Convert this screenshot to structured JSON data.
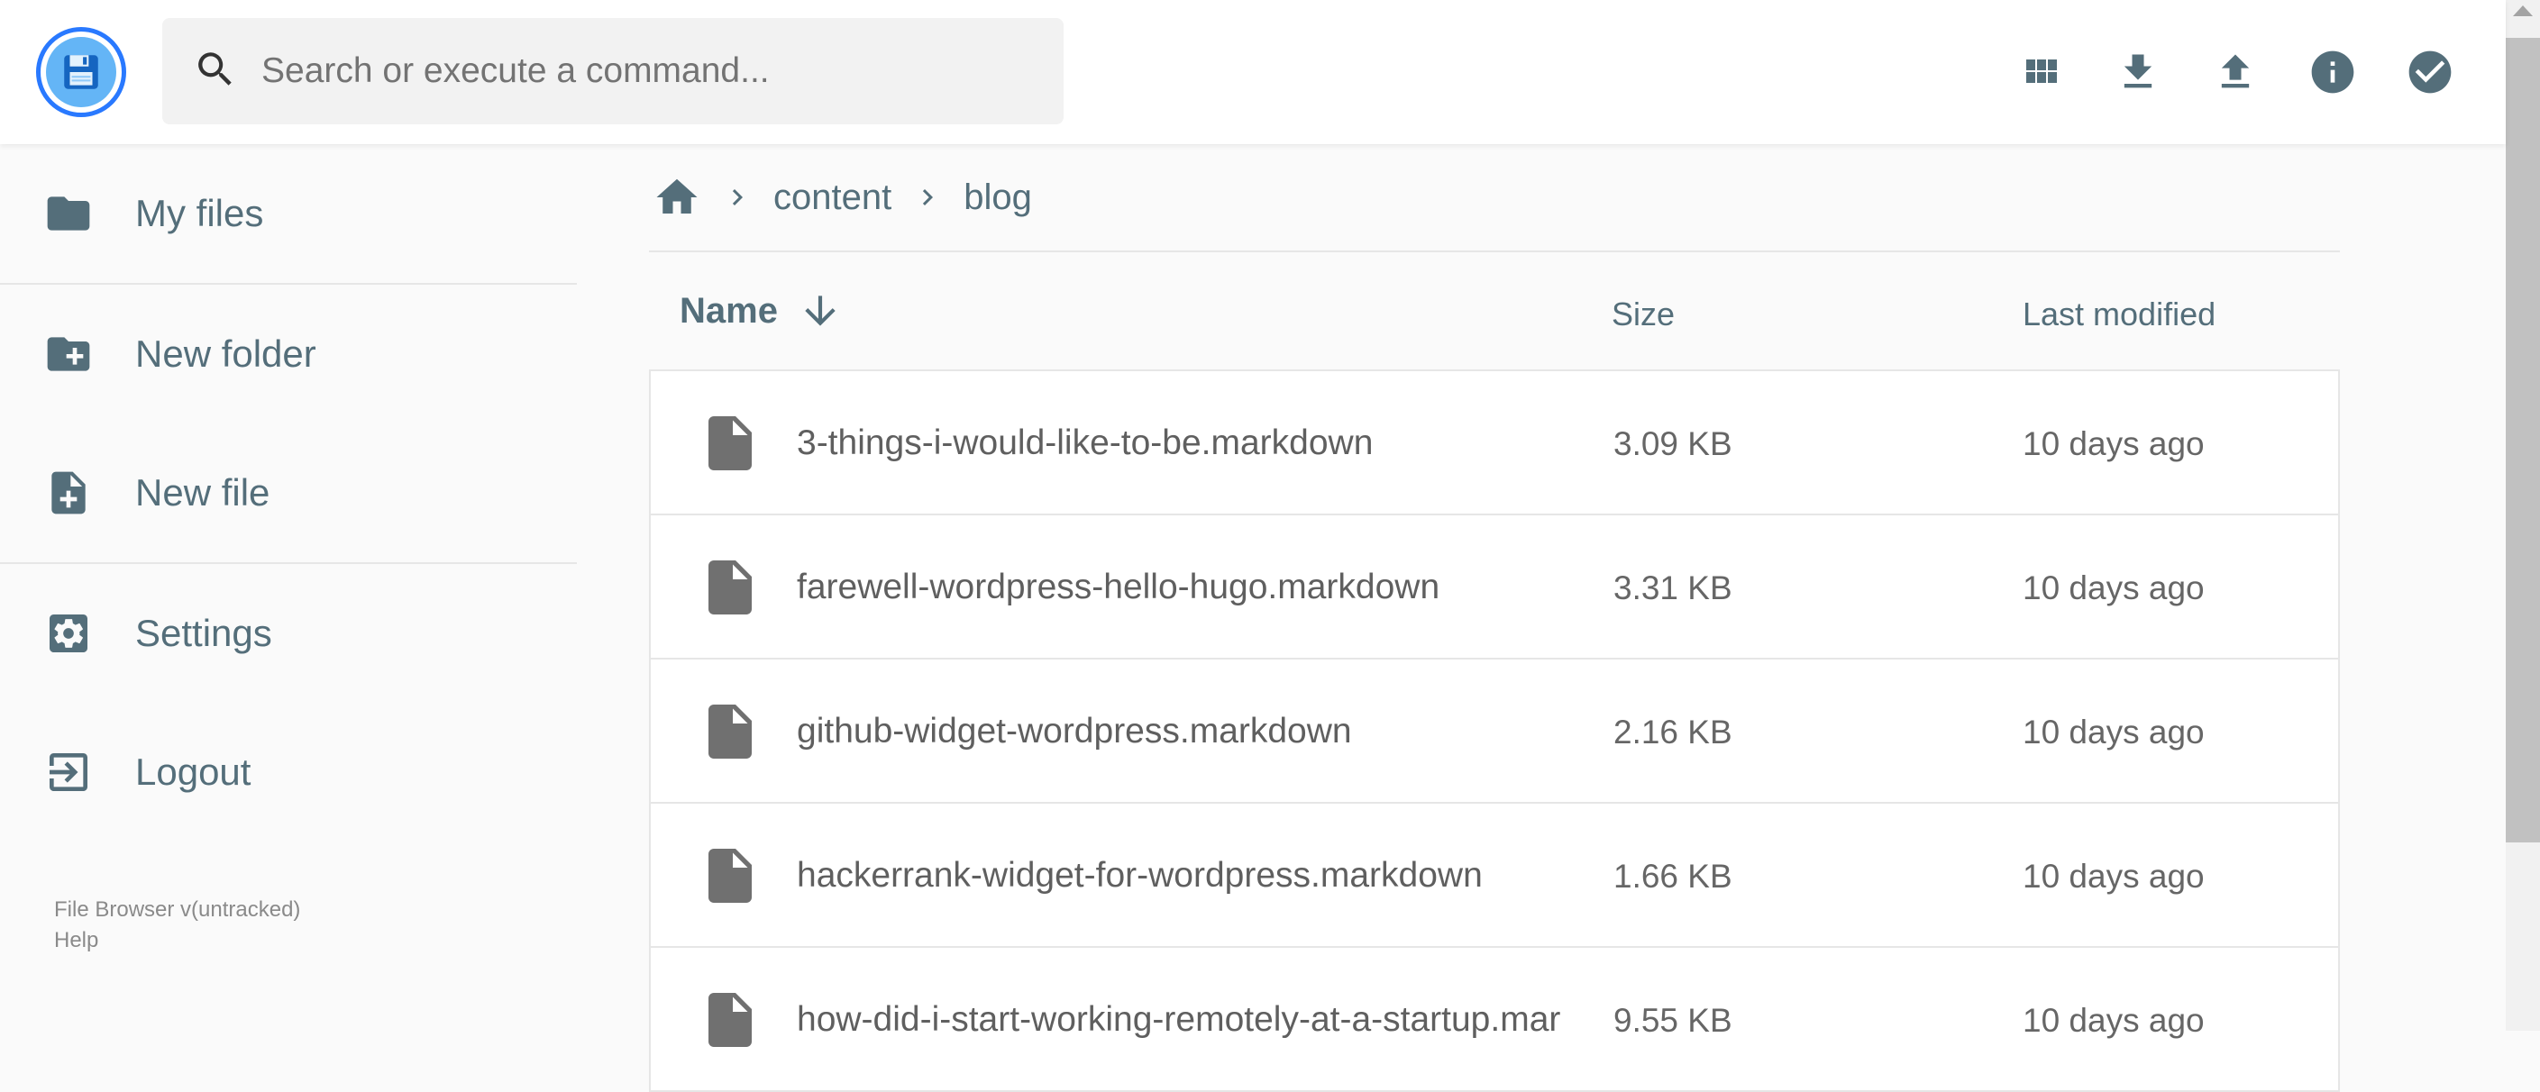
{
  "header": {
    "logo_icon": "floppy-disk-icon",
    "search_placeholder": "Search or execute a command...",
    "actions": [
      "grid-view-icon",
      "download-icon",
      "upload-icon",
      "info-icon",
      "select-check-icon"
    ]
  },
  "sidebar": {
    "items": [
      {
        "label": "My files",
        "icon": "folder-icon"
      },
      {
        "label": "New folder",
        "icon": "new-folder-icon"
      },
      {
        "label": "New file",
        "icon": "new-file-icon"
      },
      {
        "label": "Settings",
        "icon": "settings-icon"
      },
      {
        "label": "Logout",
        "icon": "logout-icon"
      }
    ],
    "footer": {
      "version": "File Browser v(untracked)",
      "help": "Help"
    }
  },
  "breadcrumbs": {
    "home_icon": "home-icon",
    "items": [
      "content",
      "blog"
    ]
  },
  "list": {
    "columns": {
      "name": "Name",
      "size": "Size",
      "modified": "Last modified"
    },
    "sort_icon": "arrow-down-icon",
    "rows": [
      {
        "name": "3-things-i-would-like-to-be.markdown",
        "size": "3.09 KB",
        "modified": "10 days ago"
      },
      {
        "name": "farewell-wordpress-hello-hugo.markdown",
        "size": "3.31 KB",
        "modified": "10 days ago"
      },
      {
        "name": "github-widget-wordpress.markdown",
        "size": "2.16 KB",
        "modified": "10 days ago"
      },
      {
        "name": "hackerrank-widget-for-wordpress.markdown",
        "size": "1.66 KB",
        "modified": "10 days ago"
      },
      {
        "name": "how-did-i-start-working-remotely-at-a-startup.mar",
        "size": "9.55 KB",
        "modified": "10 days ago"
      }
    ]
  },
  "colors": {
    "accent": "#2979ff",
    "icon": "#546e7a",
    "file_icon": "#707070"
  }
}
